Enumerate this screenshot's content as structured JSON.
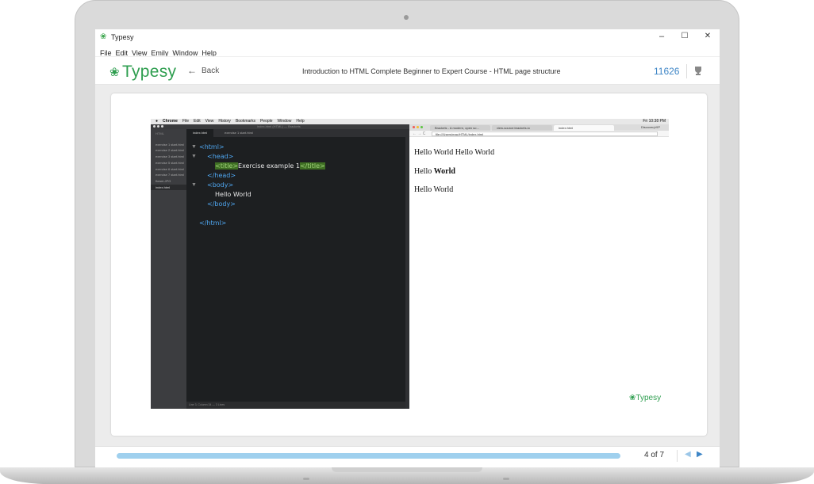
{
  "window": {
    "title": "Typesy",
    "menu": [
      "File",
      "Edit",
      "View",
      "Emily",
      "Window",
      "Help"
    ],
    "controls": {
      "minimize": "–",
      "maximize": "☐",
      "close": "✕"
    }
  },
  "header": {
    "brand": "Typesy",
    "back_label": "Back",
    "course_title": "Introduction to HTML Complete Beginner to Expert Course - HTML page structure",
    "points": "11626"
  },
  "screenshot": {
    "mac_menu": [
      "Chrome",
      "File",
      "Edit",
      "View",
      "History",
      "Bookmarks",
      "People",
      "Window",
      "Help"
    ],
    "mac_clock": "Fri 10:38 PM",
    "editor": {
      "window_title": "index.html (HTML) — Brackets",
      "sidebar_header": "HTML",
      "files": [
        "exercise 1 start.html",
        "exercise 2 start.html",
        "exercise 3 start.html",
        "exercise 5 start.html",
        "exercise 6 start.html",
        "exercise 7 start.html",
        "flower.JPG",
        "index.html"
      ],
      "tabs": [
        "index.html",
        "exercise 1 start.html"
      ],
      "status": "Line 3, Column 34 — 3 Lines",
      "code": {
        "html_open": "<html>",
        "head_open": "<head>",
        "title_open": "<title>",
        "title_text": "Exercise example 1",
        "title_close": "</title>",
        "head_close": "</head>",
        "body_open": "<body>",
        "body_text": "Hello World",
        "body_close": "</body>",
        "html_close": "</html>"
      }
    },
    "browser": {
      "tabs": [
        "Brackets - A modern, open so…",
        "view-source:brackets.io",
        "index.html"
      ],
      "profile": "DiscoveryVIP",
      "url": "file:///Users/mac/HTML/index.html",
      "lines": [
        "Hello World Hello World",
        "Hello",
        "World",
        "Hello World"
      ]
    },
    "watermark": "Typesy"
  },
  "footer": {
    "progress": 1.0,
    "page_label": "4 of 7",
    "prev_icon": "◀",
    "next_icon": "▶"
  },
  "colors": {
    "brand": "#2e9e4f",
    "accent": "#3d85c6",
    "progress": "#9fd0ee"
  }
}
